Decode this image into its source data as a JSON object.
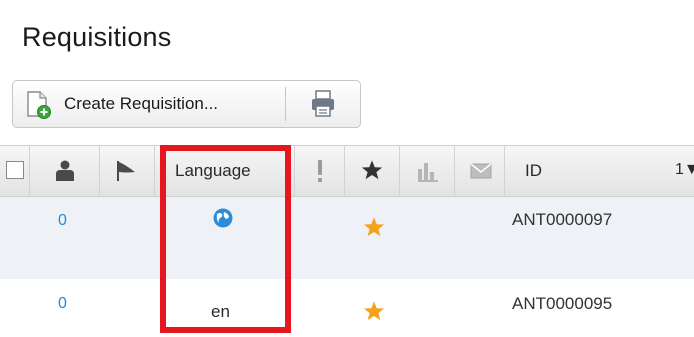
{
  "page": {
    "title": "Requisitions"
  },
  "toolbar": {
    "create_label": "Create Requisition...",
    "print_icon": "printer-icon"
  },
  "table": {
    "columns": {
      "language": "Language",
      "id": "ID",
      "sort_indicator": "1▼"
    },
    "rows": [
      {
        "count": "0",
        "language_icon": "globe-icon",
        "language_text": "",
        "starred": true,
        "id": "ANT0000097"
      },
      {
        "count": "0",
        "language_icon": "",
        "language_text": "en",
        "starred": true,
        "id": "ANT0000095"
      }
    ]
  },
  "colors": {
    "highlight": "#e5161d",
    "star": "#f5a21b",
    "link": "#2a8ad4",
    "row_alt": "#eef2f6"
  }
}
